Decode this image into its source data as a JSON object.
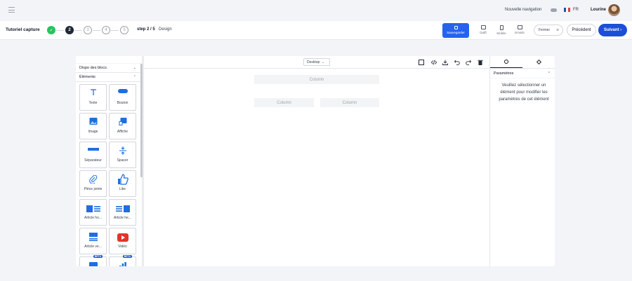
{
  "header": {
    "new_nav_label": "Nouvelle navigation",
    "language": "FR",
    "user_name": "Lourine",
    "flag_colors": [
      "#2250a6",
      "#ffffff",
      "#e63946"
    ]
  },
  "stepper": {
    "title": "Tutoriel capture",
    "steps": [
      {
        "label": "✓",
        "state": "done"
      },
      {
        "label": "2",
        "state": "current"
      },
      {
        "label": "3",
        "state": "todo"
      },
      {
        "label": "4",
        "state": "todo"
      },
      {
        "label": "5",
        "state": "todo"
      }
    ],
    "step_count": "step 2 / 5",
    "step_name": "Design"
  },
  "toolbar": {
    "save_label": "Sauvegarder",
    "tools": [
      {
        "label": "Datft",
        "icon": "comment-icon"
      },
      {
        "label": "Mobile",
        "icon": "mobile-icon"
      },
      {
        "label": "Emails",
        "icon": "mail-icon"
      }
    ],
    "close_label": "Fermer",
    "prev_label": "Précédent",
    "next_label": "Suivant ›",
    "accent": "#1d4ed8"
  },
  "left_panel": {
    "sections": [
      {
        "label": "Dispo des blocs",
        "chevron": "⌄"
      },
      {
        "label": "Éléments",
        "chevron": "⌃"
      }
    ],
    "elements": [
      {
        "label": "Texte",
        "icon": "text-icon"
      },
      {
        "label": "Bouton",
        "icon": "button-icon"
      },
      {
        "label": "Image",
        "icon": "image-icon"
      },
      {
        "label": "Affiche",
        "icon": "poster-icon"
      },
      {
        "label": "Séparateur",
        "icon": "separator-icon"
      },
      {
        "label": "Spacer",
        "icon": "spacer-icon"
      },
      {
        "label": "Pièce jointe",
        "icon": "paperclip-icon"
      },
      {
        "label": "Like",
        "icon": "thumbs-up-icon"
      },
      {
        "label": "Article ho...",
        "icon": "article-horizontal-icon"
      },
      {
        "label": "Article he...",
        "icon": "article-horizontal-reverse-icon"
      },
      {
        "label": "Article ve...",
        "icon": "article-vertical-icon"
      },
      {
        "label": "Vidéo",
        "icon": "video-icon"
      },
      {
        "label": "",
        "icon": "beta-block-icon",
        "badge": "BETA"
      },
      {
        "label": "",
        "icon": "beta-chart-icon",
        "badge": "BETA"
      }
    ]
  },
  "canvas": {
    "device": "Desktop",
    "columns": [
      "Column",
      "Column",
      "Column"
    ]
  },
  "right_panel": {
    "section_title": "Paramètres",
    "message": "Veuillez sélectionner un élément pour modifier les paramètres de cet élément"
  }
}
